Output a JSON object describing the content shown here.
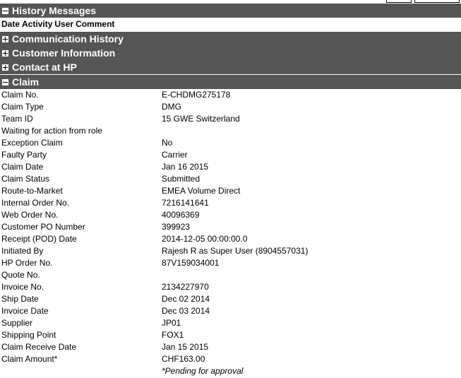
{
  "sections": {
    "history": "History Messages",
    "communication": "Communication History",
    "customer": "Customer Information",
    "contact": "Contact at HP",
    "claim": "Claim"
  },
  "history_columns": [
    "Date",
    "Activity",
    "User",
    "Comment"
  ],
  "claim_fields": [
    {
      "label": "Claim No.",
      "value": "E-CHDMG275178"
    },
    {
      "label": "Claim Type",
      "value": "DMG"
    },
    {
      "label": "Team ID",
      "value": "15 GWE Switzerland"
    },
    {
      "label": "Waiting for action from role",
      "value": ""
    },
    {
      "label": "Exception Claim",
      "value": "No"
    },
    {
      "label": "Faulty Party",
      "value": "Carrier"
    },
    {
      "label": "Claim Date",
      "value": "Jan 16 2015"
    },
    {
      "label": "Claim Status",
      "value": "Submitted"
    },
    {
      "label": "Route-to-Market",
      "value": "EMEA Volume Direct"
    },
    {
      "label": "Internal Order No.",
      "value": "7216141641"
    },
    {
      "label": "Web Order No.",
      "value": "40096369"
    },
    {
      "label": "Customer PO Number",
      "value": "399923"
    },
    {
      "label": "Receipt (POD) Date",
      "value": "2014-12-05 00:00:00.0"
    },
    {
      "label": "Initiated By",
      "value": "Rajesh R as Super User (8904557031)"
    },
    {
      "label": "HP Order No.",
      "value": "87V159034001"
    },
    {
      "label": "Quote No.",
      "value": ""
    },
    {
      "label": "Invoice No.",
      "value": "2134227970"
    },
    {
      "label": "Ship Date",
      "value": "Dec 02 2014"
    },
    {
      "label": "Invoice Date",
      "value": "Dec 03 2014"
    },
    {
      "label": "Supplier",
      "value": "JP01"
    },
    {
      "label": "Shipping Point",
      "value": "FOX1"
    },
    {
      "label": "Claim Receive Date",
      "value": "Jan 15 2015"
    },
    {
      "label": "Claim Amount*",
      "value": "CHF163.00"
    }
  ],
  "pending_note": "*Pending for approval",
  "colors": {
    "header_bg": "#555555",
    "header_text": "#ffffff"
  },
  "icons": {
    "expanded": "minus-box-icon",
    "collapsed": "plus-box-icon"
  }
}
